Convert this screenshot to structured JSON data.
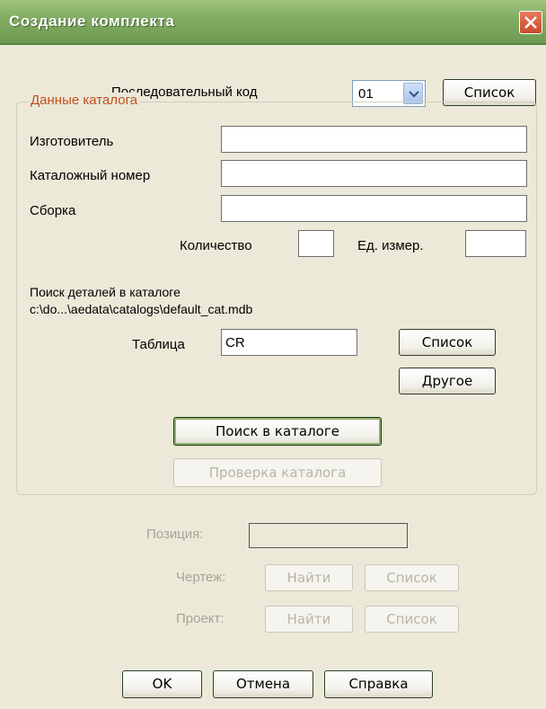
{
  "window": {
    "title": "Создание комплекта"
  },
  "seq": {
    "label": "Последовательный код",
    "value": "01",
    "list_button": "Список"
  },
  "catalog": {
    "legend": "Данные каталога",
    "manufacturer_label": "Изготовитель",
    "catalog_number_label": "Каталожный номер",
    "assembly_label": "Сборка",
    "quantity_label": "Количество",
    "unit_label": "Ед. измер.",
    "search_line1": "Поиск деталей в каталоге",
    "search_line2": "c:\\do...\\aedata\\catalogs\\default_cat.mdb",
    "table_label": "Таблица",
    "table_value": "CR",
    "table_list_button": "Список",
    "other_button": "Другое",
    "search_button": "Поиск в каталоге",
    "check_button": "Проверка каталога"
  },
  "position": {
    "label": "Позиция:",
    "drawing_label": "Чертеж:",
    "project_label": "Проект:",
    "find_button": "Найти",
    "list_button": "Список"
  },
  "footer": {
    "ok": "OK",
    "cancel": "Отмена",
    "help": "Справка"
  }
}
